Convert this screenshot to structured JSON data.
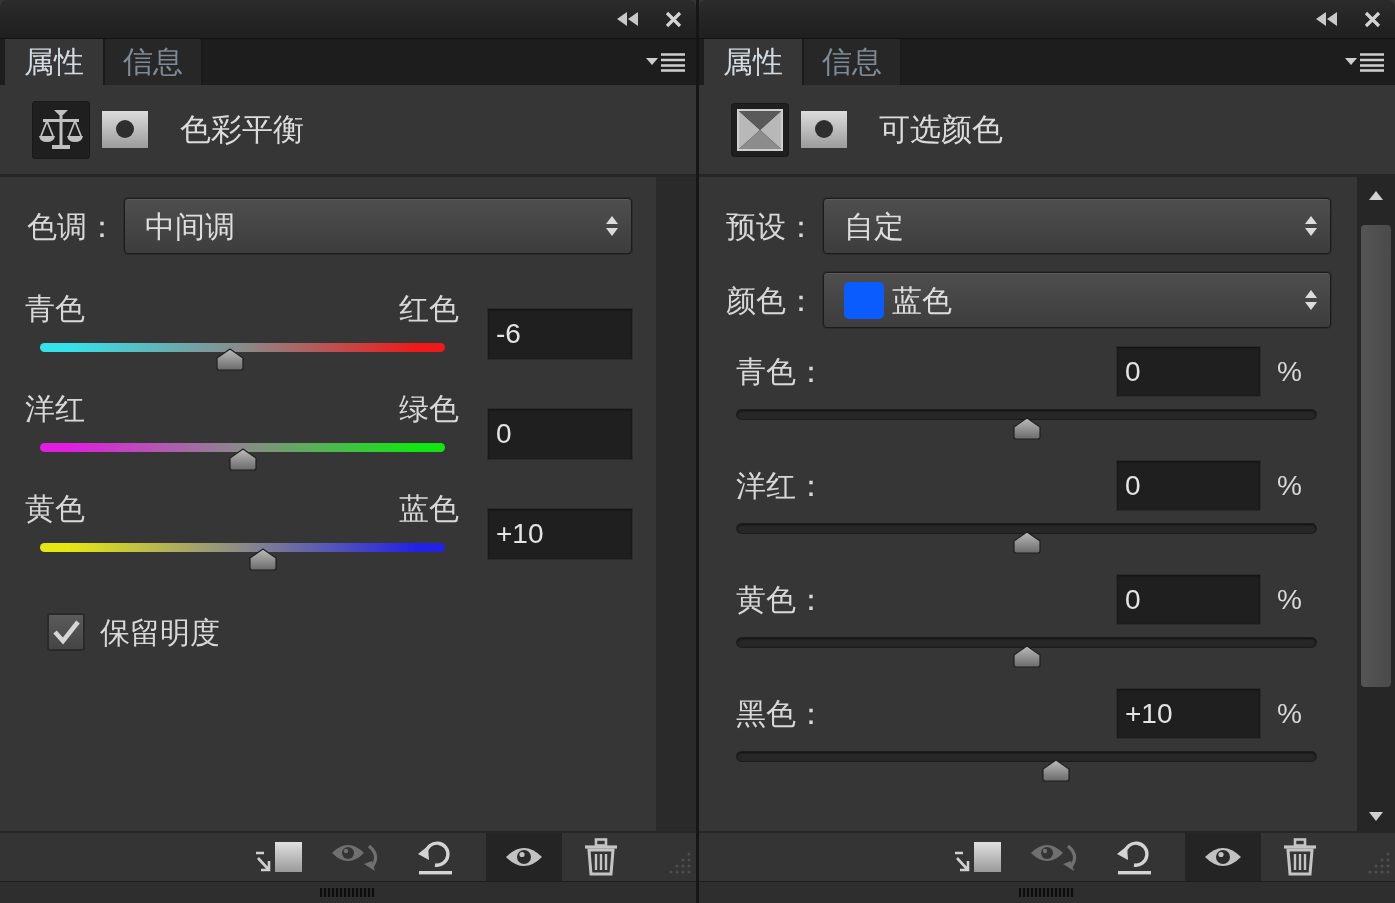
{
  "panels": [
    {
      "tabs": [
        {
          "label": "属性",
          "selected": true
        },
        {
          "label": "信息",
          "selected": false
        }
      ],
      "header_buttons": [
        {
          "kind": "balance",
          "selected": true
        },
        {
          "kind": "mask",
          "selected": false
        }
      ],
      "title": "色彩平衡",
      "dropdowns": [
        {
          "label": "色调：",
          "value": "中间调"
        }
      ],
      "balance_sliders": [
        {
          "ends": [
            {
              "label": "青色",
              "color": "#35e2ea"
            },
            {
              "label": "红色",
              "color": "#ee1a1a"
            }
          ],
          "level": 0.47,
          "value": "-6"
        },
        {
          "ends": [
            {
              "label": "洋红",
              "color": "#e01ee0"
            },
            {
              "label": "绿色",
              "color": "#12e612"
            }
          ],
          "level": 0.5,
          "value": "0"
        },
        {
          "ends": [
            {
              "label": "黄色",
              "color": "#e6e612"
            },
            {
              "label": "蓝色",
              "color": "#2222e6"
            }
          ],
          "level": 0.55,
          "value": "+10"
        }
      ],
      "checkbox": {
        "label": "保留明度",
        "checked": true
      },
      "scrollable": false,
      "visibility_on": true
    },
    {
      "tabs": [
        {
          "label": "属性",
          "selected": true
        },
        {
          "label": "信息",
          "selected": false
        }
      ],
      "header_buttons": [
        {
          "kind": "selective",
          "selected": true
        },
        {
          "kind": "mask",
          "selected": false
        }
      ],
      "title": "可选颜色",
      "dropdowns": [
        {
          "label": "预设：",
          "value": "自定"
        },
        {
          "label": "颜色：",
          "value": "蓝色",
          "color": "#0a5cff"
        }
      ],
      "percent_sliders": [
        {
          "label": "青色：",
          "value": "0",
          "unit": "%",
          "level": 0.5
        },
        {
          "label": "洋红：",
          "value": "0",
          "unit": "%",
          "level": 0.5
        },
        {
          "label": "黄色：",
          "value": "0",
          "unit": "%",
          "level": 0.5
        },
        {
          "label": "黑色：",
          "value": "+10",
          "unit": "%",
          "level": 0.55
        }
      ],
      "scrollable": true,
      "visibility_on": true
    }
  ]
}
